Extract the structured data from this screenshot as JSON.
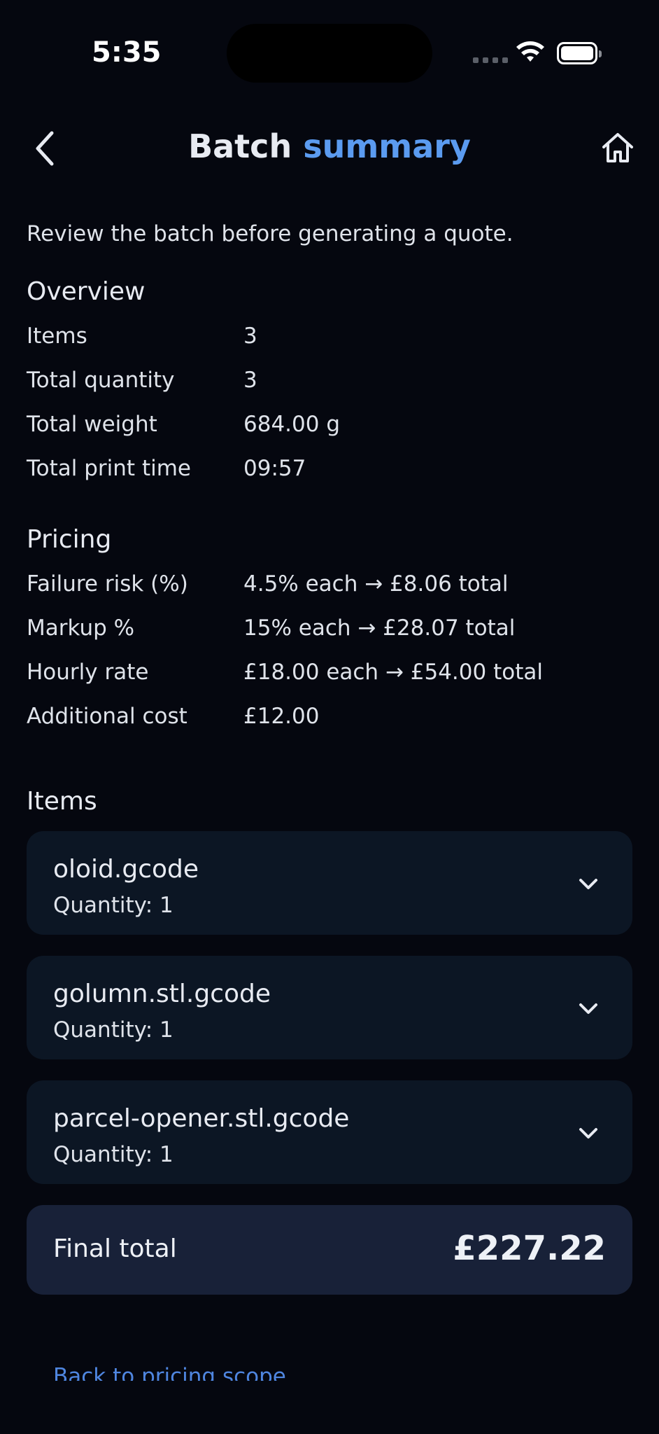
{
  "status_bar": {
    "time": "5:35"
  },
  "header": {
    "title_part1": "Batch",
    "title_part2": "summary"
  },
  "intro": "Review the batch before generating a quote.",
  "overview": {
    "title": "Overview",
    "rows": [
      {
        "label": "Items",
        "value": "3"
      },
      {
        "label": "Total quantity",
        "value": "3"
      },
      {
        "label": "Total weight",
        "value": "684.00 g"
      },
      {
        "label": "Total print time",
        "value": "09:57"
      }
    ]
  },
  "pricing": {
    "title": "Pricing",
    "rows": [
      {
        "label": "Failure risk (%)",
        "value": "4.5% each → £8.06 total"
      },
      {
        "label": "Markup %",
        "value": "15% each → £28.07 total"
      },
      {
        "label": "Hourly rate",
        "value": "£18.00 each → £54.00 total"
      },
      {
        "label": "Additional cost",
        "value": "£12.00"
      }
    ]
  },
  "items": {
    "title": "Items",
    "list": [
      {
        "name": "oloid.gcode",
        "quantity": "Quantity: 1"
      },
      {
        "name": "golumn.stl.gcode",
        "quantity": "Quantity: 1"
      },
      {
        "name": "parcel-opener.stl.gcode",
        "quantity": "Quantity: 1"
      }
    ]
  },
  "final_total": {
    "label": "Final total",
    "amount": "£227.22"
  },
  "footer": {
    "link": "Back to pricing scope"
  },
  "colors": {
    "background": "#05070f",
    "accent": "#5b9bf0",
    "card": "#0c1624",
    "total_card": "#182138",
    "link": "#4f86e0"
  },
  "icons": [
    "back-chevron-icon",
    "home-icon",
    "chevron-down-icon",
    "wifi-icon",
    "battery-icon",
    "signal-icon"
  ]
}
